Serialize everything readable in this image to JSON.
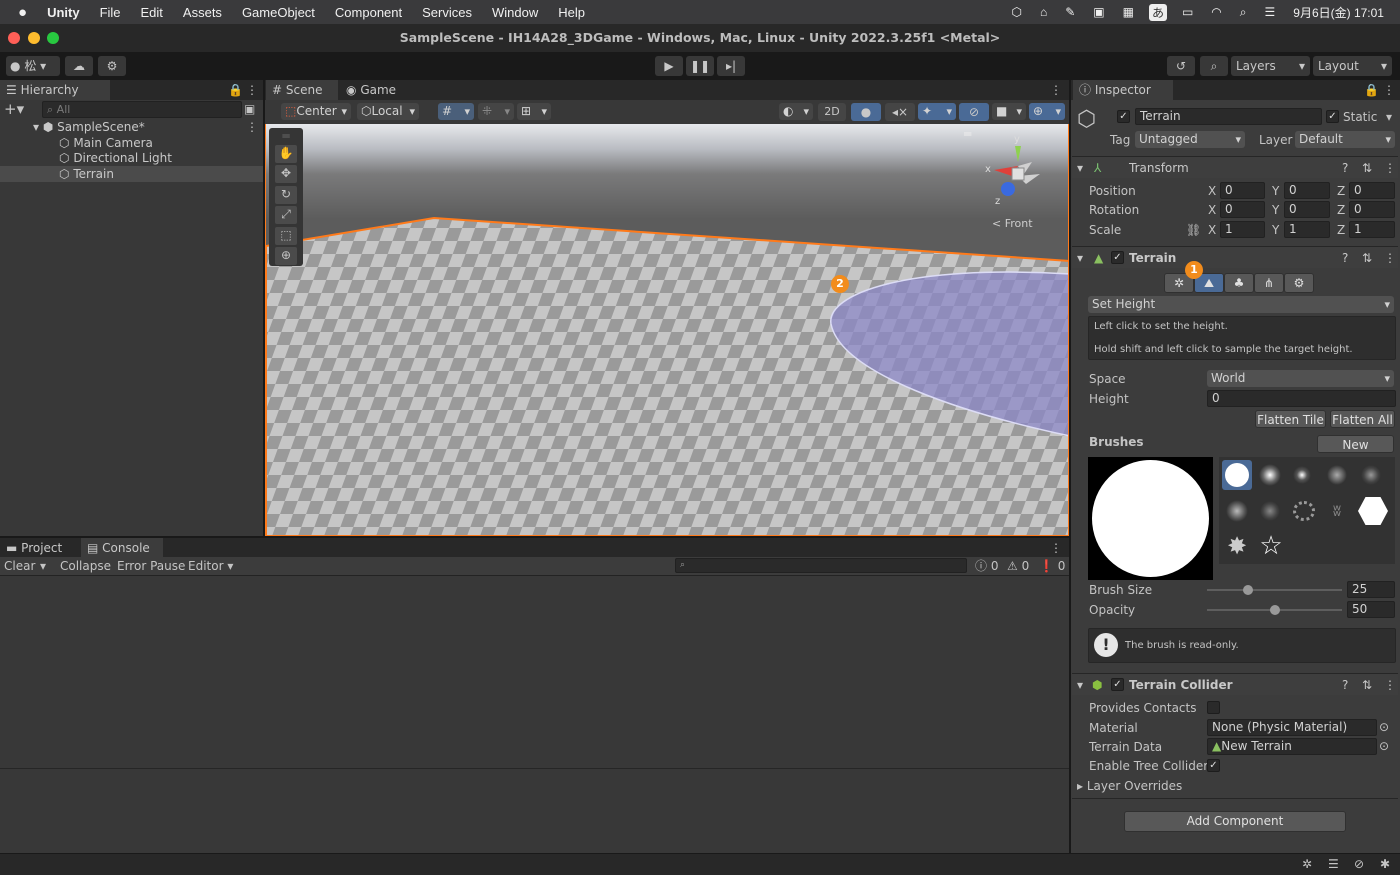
{
  "menubar": {
    "apple_icon": "apple-icon",
    "app_name": "Unity",
    "items": [
      "File",
      "Edit",
      "Assets",
      "GameObject",
      "Component",
      "Services",
      "Window",
      "Help"
    ],
    "ime": "あ",
    "date_time": "9月6日(金) 17:01"
  },
  "window": {
    "title": "SampleScene - IH14A28_3DGame - Windows, Mac, Linux - Unity 2022.3.25f1 <Metal>"
  },
  "toolbar": {
    "account_label": "松",
    "layers_label": "Layers",
    "layout_label": "Layout"
  },
  "hierarchy": {
    "tab_label": "Hierarchy",
    "search_placeholder": "All",
    "scene_name": "SampleScene*",
    "items": [
      "Main Camera",
      "Directional Light",
      "Terrain"
    ]
  },
  "scene_view": {
    "tabs": [
      "Scene",
      "Game"
    ],
    "pivot_label": "Center",
    "space_label": "Local",
    "mode_2d": "2D",
    "gizmo_view_label": "< Front",
    "axis_y": "y",
    "axis_x": "x",
    "axis_z": "z",
    "badge_2": "2"
  },
  "console": {
    "tabs": [
      "Project",
      "Console"
    ],
    "clear_label": "Clear",
    "collapse_label": "Collapse",
    "error_pause_label": "Error Pause",
    "editor_label": "Editor",
    "log_count": "0",
    "warn_count": "0",
    "error_count": "0"
  },
  "inspector": {
    "tab_label": "Inspector",
    "object_name": "Terrain",
    "static_label": "Static",
    "tag_label": "Tag",
    "tag_value": "Untagged",
    "layer_label": "Layer",
    "layer_value": "Default",
    "transform": {
      "title": "Transform",
      "rows": [
        {
          "label": "Position",
          "x": "0",
          "y": "0",
          "z": "0"
        },
        {
          "label": "Rotation",
          "x": "0",
          "y": "0",
          "z": "0"
        },
        {
          "label": "Scale",
          "x": "1",
          "y": "1",
          "z": "1"
        }
      ],
      "axis_x": "X",
      "axis_y": "Y",
      "axis_z": "Z"
    },
    "terrain": {
      "title": "Terrain",
      "badge_1": "1",
      "tool_value": "Set Height",
      "help_line1": "Left click to set the height.",
      "help_line2": "Hold shift and left click to sample the target height.",
      "space_label": "Space",
      "space_value": "World",
      "height_label": "Height",
      "height_value": "0",
      "flatten_tile": "Flatten Tile",
      "flatten_all": "Flatten All",
      "brushes_label": "Brushes",
      "new_brush": "New Brush...",
      "brush_size_label": "Brush Size",
      "brush_size_value": "25",
      "brush_size_fraction": 0.3,
      "opacity_label": "Opacity",
      "opacity_value": "50",
      "opacity_fraction": 0.5,
      "readonly_msg": "The brush is read-only."
    },
    "collider": {
      "title": "Terrain Collider",
      "provides_contacts": "Provides Contacts",
      "material_label": "Material",
      "material_value": "None (Physic Material)",
      "terrain_data_label": "Terrain Data",
      "terrain_data_value": "New Terrain",
      "enable_tree": "Enable Tree Colliders",
      "layer_overrides": "Layer Overrides"
    },
    "add_component": "Add Component"
  },
  "colors": {
    "accent": "#f28c1c",
    "selection_outline": "#ff7a1a",
    "brush_preview": "#8a87c8"
  }
}
